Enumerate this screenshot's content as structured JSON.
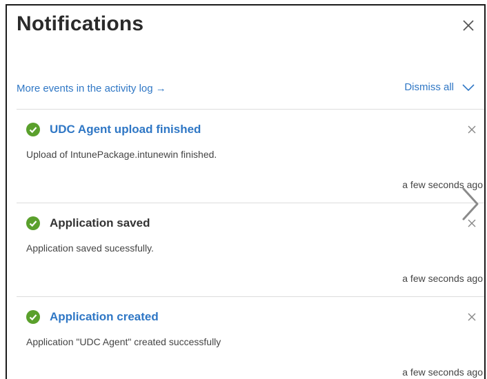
{
  "panel": {
    "title": "Notifications",
    "activity_link": "More events in the activity log →",
    "dismiss_all": "Dismiss all"
  },
  "notifications": [
    {
      "title": "UDC Agent upload finished",
      "description": "Upload of IntunePackage.intunewin finished.",
      "time": "a few seconds ago",
      "status": "success"
    },
    {
      "title": "Application saved",
      "description": "Application saved sucessfully.",
      "time": "a few seconds ago",
      "status": "success"
    },
    {
      "title": "Application created",
      "description": "Application \"UDC Agent\" created successfully",
      "time": "a few seconds ago",
      "status": "success"
    }
  ],
  "colors": {
    "link": "#2f77c5",
    "success": "#5aa02c",
    "text": "#444444",
    "divider": "#dcdcdc"
  },
  "icons": {
    "close": "close-icon",
    "chevron": "chevron-down-icon",
    "status": "check-circle-icon",
    "scroll": "chevron-right-icon"
  }
}
